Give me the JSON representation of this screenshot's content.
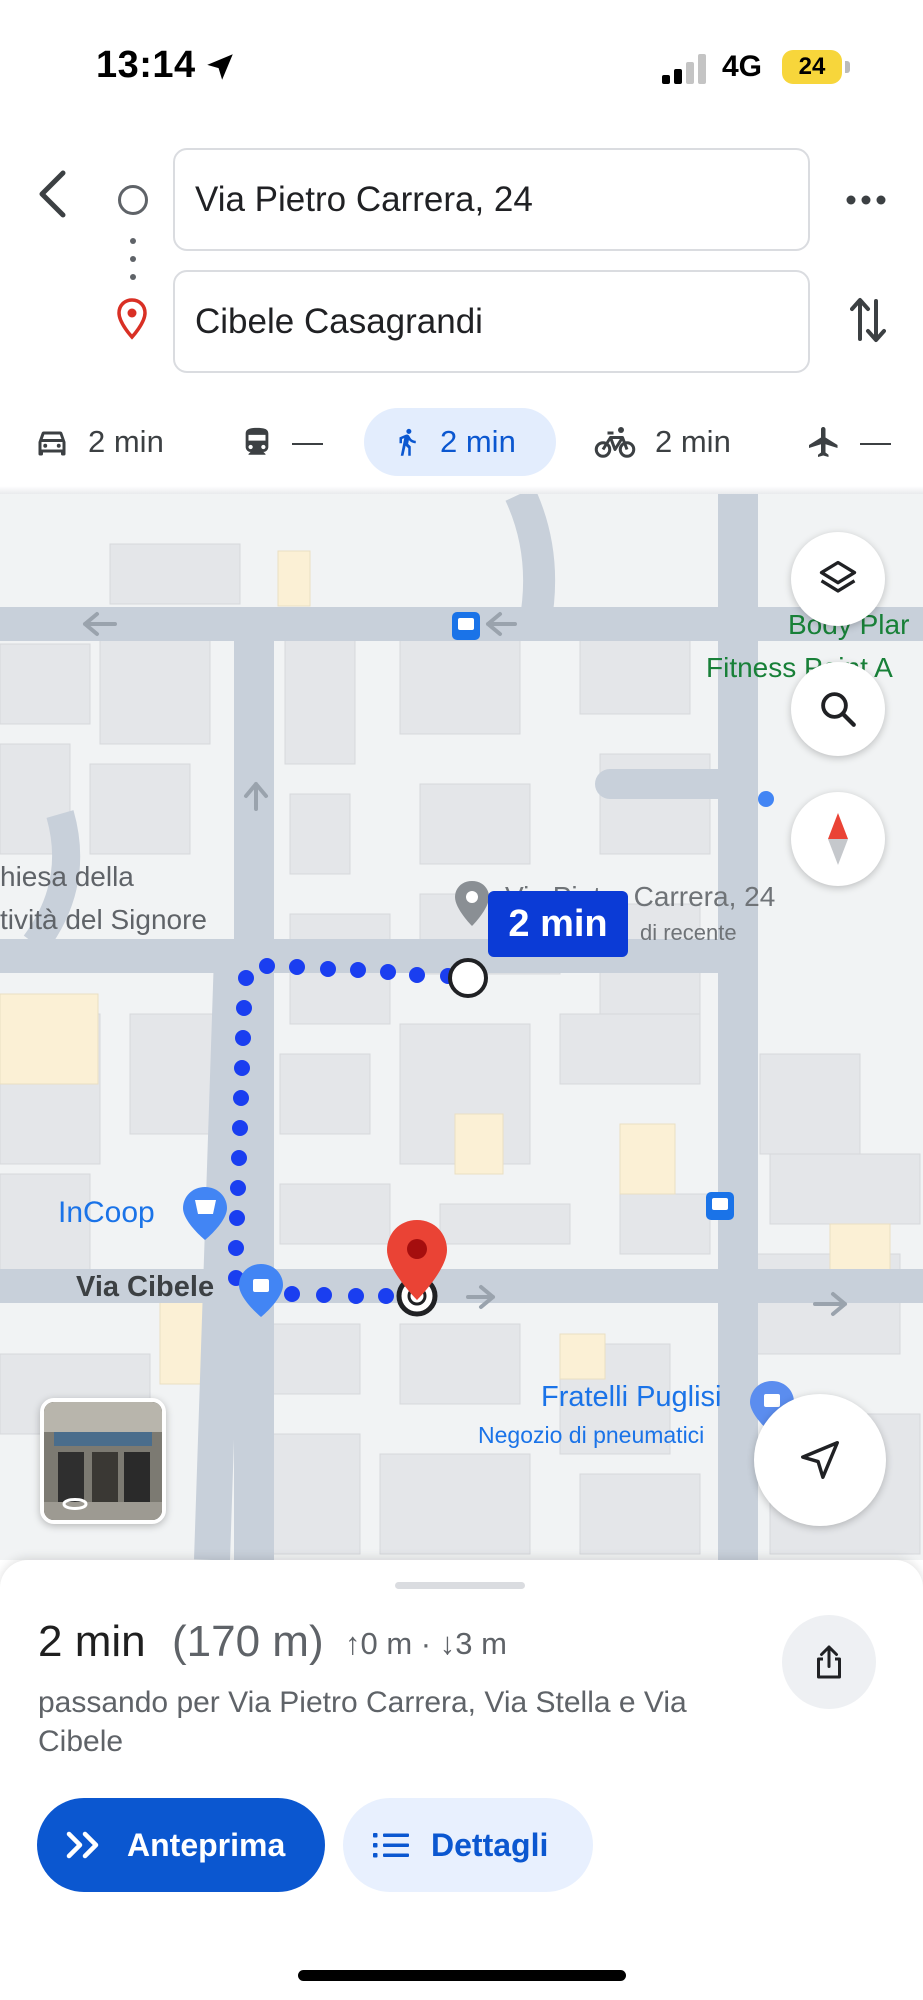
{
  "status_bar": {
    "time": "13:14",
    "network": "4G",
    "battery": "24",
    "icons": [
      "location-arrow-icon",
      "signal-icon",
      "battery-icon"
    ]
  },
  "directions": {
    "origin": "Via Pietro Carrera, 24",
    "destination": "Cibele Casagrandi",
    "icons": [
      "back-arrow-icon",
      "origin-circle-icon",
      "destination-pin-icon",
      "more-icon",
      "swap-icon"
    ]
  },
  "modes": [
    {
      "id": "car",
      "icon": "car-icon",
      "label": "2 min"
    },
    {
      "id": "transit",
      "icon": "train-icon",
      "label": "—"
    },
    {
      "id": "walk",
      "icon": "walk-icon",
      "label": "2 min",
      "selected": true
    },
    {
      "id": "bike",
      "icon": "bike-icon",
      "label": "2 min"
    },
    {
      "id": "flight",
      "icon": "plane-icon",
      "label": "—"
    }
  ],
  "map": {
    "labels": {
      "church_line1": "hiesa della",
      "church_line2": "tività del Signore",
      "gym_line1": "Body Plar",
      "gym_line2": "Fitness Point A",
      "origin_pin_label": "Via Pietro Carrera, 24",
      "origin_pin_sub": "di recente",
      "store": "InCoop",
      "street": "Via Cibele",
      "tire_shop": "Fratelli Puglisi",
      "tire_shop_sub": "Negozio di pneumatici"
    },
    "eta_bubble": "2 min",
    "route_color": "#1a3ef0",
    "dest_pin_color": "#ea4335",
    "controls": [
      "layers-icon",
      "search-icon",
      "compass-icon",
      "recenter-icon",
      "street-view-icon"
    ]
  },
  "route": {
    "duration": "2 min",
    "distance": "(170 m)",
    "elevation": "↑0 m · ↓3 m",
    "via": "passando per Via Pietro Carrera, Via Stella e Via Cibele",
    "preview_label": "Anteprima",
    "details_label": "Dettagli",
    "accent": "#0b57d0"
  }
}
